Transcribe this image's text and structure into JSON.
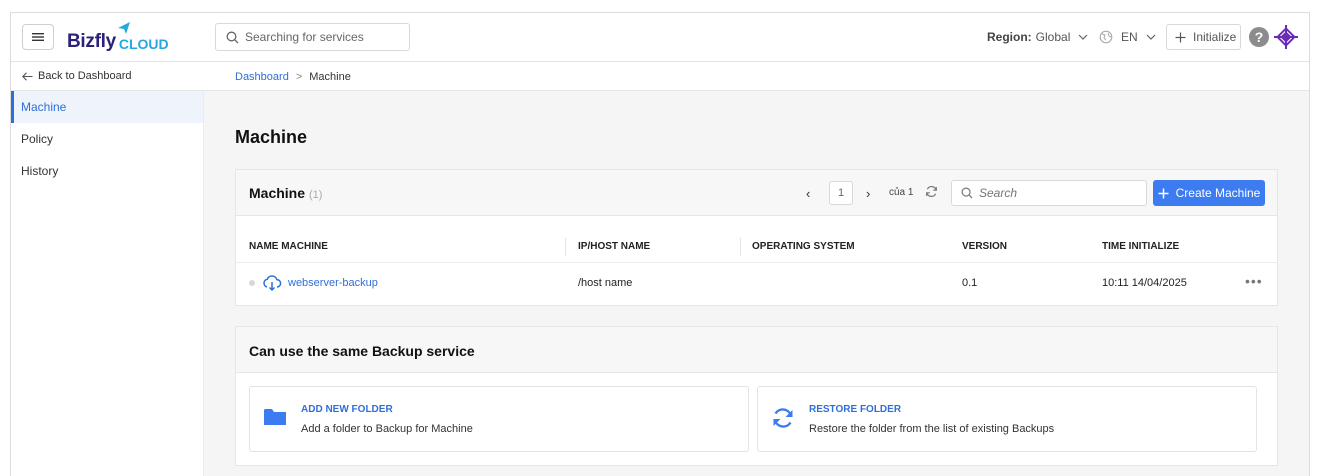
{
  "header": {
    "brand_main": "Bizfly",
    "brand_sub": "CLOUD",
    "search_placeholder": "Searching for services",
    "region_label": "Region:",
    "region_value": "Global",
    "language": "EN",
    "initialize_label": "Initialize",
    "help_symbol": "?"
  },
  "nav": {
    "back_label": "Back to Dashboard",
    "breadcrumb": [
      "Dashboard",
      "Machine"
    ],
    "breadcrumb_sep": ">"
  },
  "sidebar": {
    "items": [
      {
        "label": "Machine",
        "active": true
      },
      {
        "label": "Policy",
        "active": false
      },
      {
        "label": "History",
        "active": false
      }
    ]
  },
  "main": {
    "page_title": "Machine",
    "machine_card": {
      "title": "Machine",
      "count": "(1)",
      "pagination": {
        "prev": "‹",
        "page": "1",
        "next": "›",
        "of_label": "của 1"
      },
      "search_placeholder": "Search",
      "create_label": "Create Machine",
      "columns": [
        "NAME MACHINE",
        "IP/HOST NAME",
        "OPERATING SYSTEM",
        "VERSION",
        "TIME INITIALIZE"
      ],
      "rows": [
        {
          "name": "webserver-backup",
          "host": "/host name",
          "os": "",
          "version": "0.1",
          "time": "10:11 14/04/2025"
        }
      ],
      "row_actions": "•••"
    },
    "same_service": {
      "title": "Can use the same Backup service",
      "options": [
        {
          "title": "ADD NEW FOLDER",
          "desc": "Add a folder to Backup for Machine",
          "icon": "folder-icon"
        },
        {
          "title": "RESTORE FOLDER",
          "desc": "Restore the folder from the list of existing Backups",
          "icon": "restore-icon"
        }
      ]
    }
  },
  "colors": {
    "accent": "#3d7cf0",
    "link": "#2f6fd8",
    "brand_dark": "#2a2279",
    "brand_light": "#25a8e0"
  }
}
